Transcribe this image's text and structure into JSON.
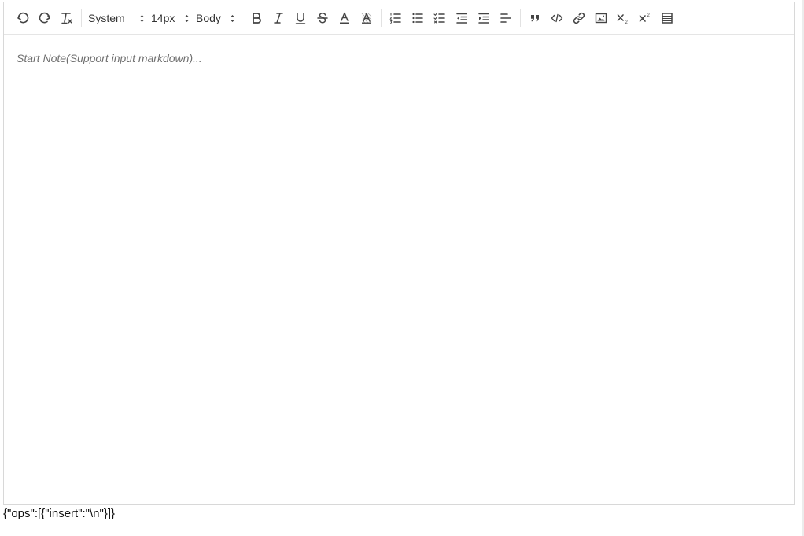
{
  "toolbar": {
    "font_picker": "System",
    "size_picker": "14px",
    "header_picker": "Body",
    "buttons": [
      {
        "icon": "undo-icon"
      },
      {
        "icon": "redo-icon"
      },
      {
        "icon": "clear-format-icon"
      },
      {
        "icon": "bold-icon"
      },
      {
        "icon": "italic-icon"
      },
      {
        "icon": "underline-icon"
      },
      {
        "icon": "strikethrough-icon"
      },
      {
        "icon": "text-color-icon"
      },
      {
        "icon": "background-color-icon"
      },
      {
        "icon": "ordered-list-icon"
      },
      {
        "icon": "bullet-list-icon"
      },
      {
        "icon": "checklist-icon"
      },
      {
        "icon": "outdent-icon"
      },
      {
        "icon": "indent-icon"
      },
      {
        "icon": "align-left-icon"
      },
      {
        "icon": "blockquote-icon"
      },
      {
        "icon": "code-block-icon"
      },
      {
        "icon": "link-icon"
      },
      {
        "icon": "image-icon"
      },
      {
        "icon": "subscript-icon"
      },
      {
        "icon": "superscript-icon"
      },
      {
        "icon": "table-icon"
      }
    ]
  },
  "editor": {
    "placeholder": "Start Note(Support input markdown)...",
    "value": ""
  },
  "output": {
    "delta_json": "{\"ops\":[{\"insert\":\"\\n\"}]}"
  }
}
